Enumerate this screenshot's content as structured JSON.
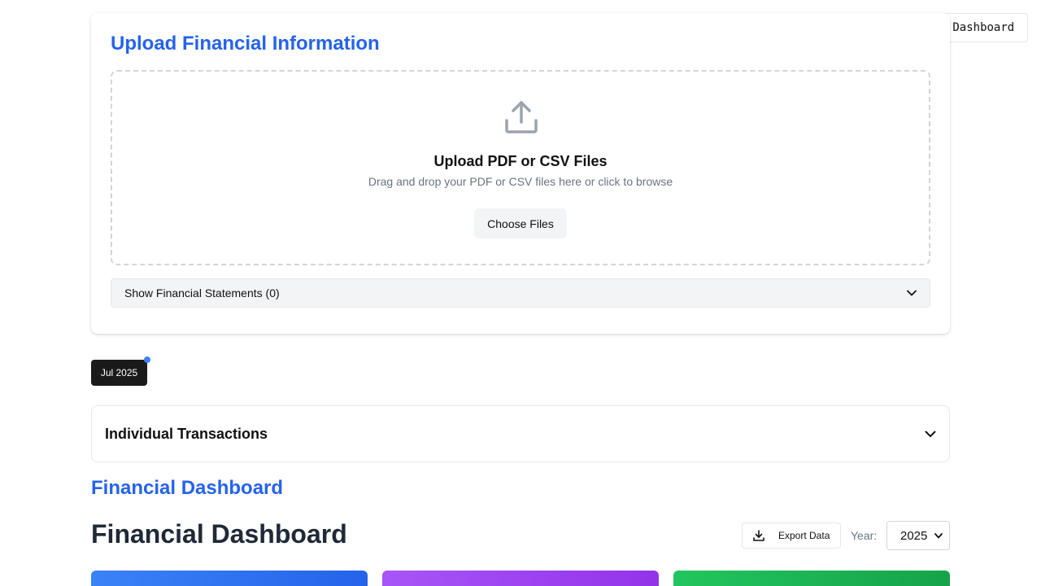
{
  "header": {
    "reset_label": "Reset Dashboard"
  },
  "upload": {
    "title": "Upload Financial Information",
    "dropzone_title": "Upload PDF or CSV Files",
    "dropzone_subtitle": "Drag and drop your PDF or CSV files here or click to browse",
    "choose_label": "Choose Files",
    "statements_toggle_label": "Show Financial Statements (0)",
    "icon": "upload-icon"
  },
  "months": [
    {
      "label": "Jul 2025",
      "has_indicator": true
    }
  ],
  "transactions": {
    "title": "Individual Transactions"
  },
  "dashboard": {
    "section_heading": "Financial Dashboard",
    "title": "Financial Dashboard",
    "export_label": "Export Data",
    "year_label": "Year:",
    "year_value": "2025"
  },
  "colors": {
    "accent": "#2563eb",
    "card_blue": "#3b82f6",
    "card_purple": "#a855f7",
    "card_green": "#22c55e"
  }
}
